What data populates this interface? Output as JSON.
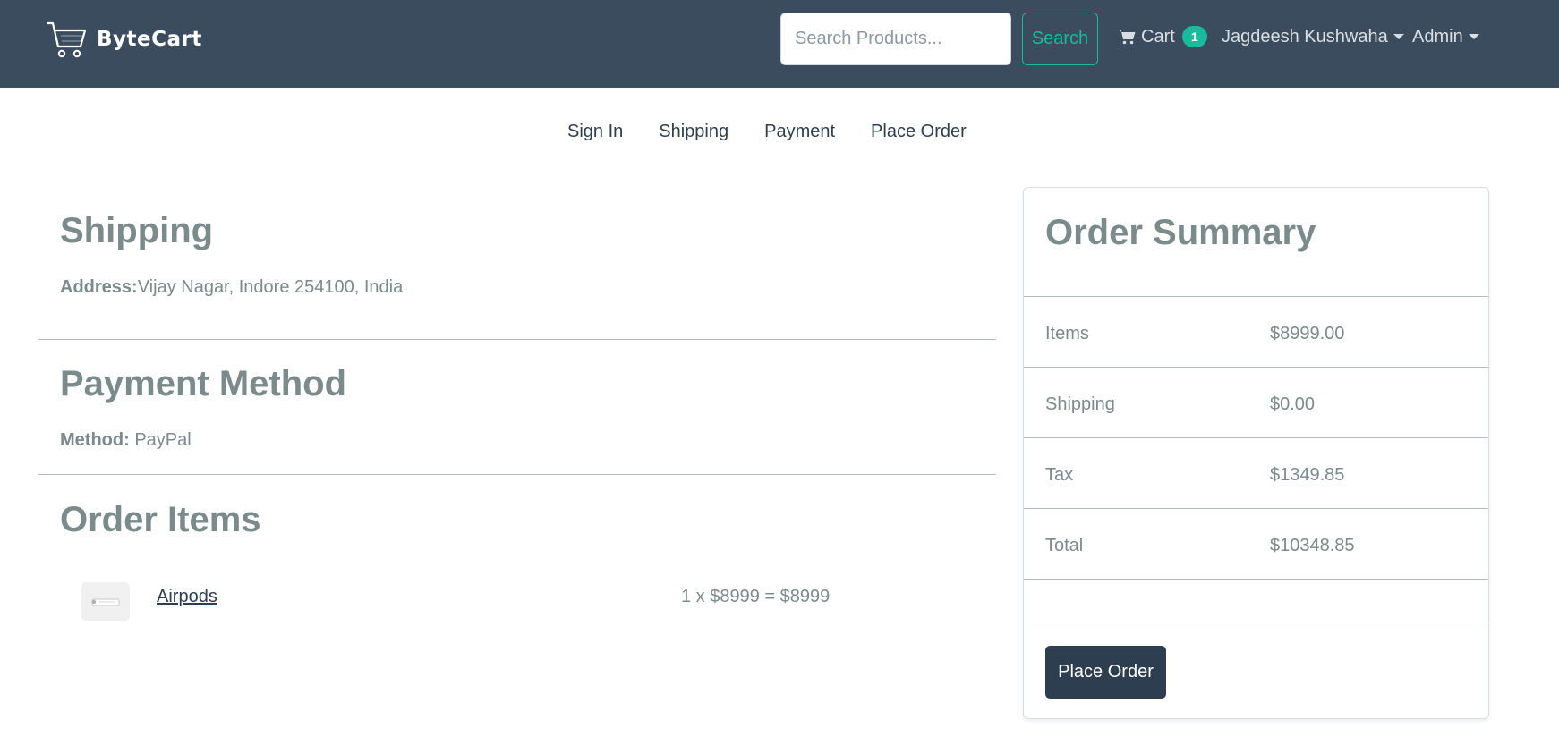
{
  "header": {
    "brand": "ByteCart",
    "search": {
      "placeholder": "Search Products...",
      "button_label": "Search"
    },
    "cart": {
      "label": "Cart",
      "count": "1"
    },
    "user_menu": "Jagdeesh Kushwaha",
    "admin_menu": "Admin"
  },
  "steps": [
    "Sign In",
    "Shipping",
    "Payment",
    "Place Order"
  ],
  "shipping": {
    "title": "Shipping",
    "address_label": "Address:",
    "address_value": "Vijay Nagar, Indore 254100, India"
  },
  "payment": {
    "title": "Payment Method",
    "method_label": "Method:",
    "method_value": "PayPal"
  },
  "order_items": {
    "title": "Order Items",
    "items": [
      {
        "name": "Airpods",
        "calc": "1 x $8999 = $8999"
      }
    ]
  },
  "summary": {
    "title": "Order Summary",
    "rows": [
      {
        "label": "Items",
        "value": "$8999.00"
      },
      {
        "label": "Shipping",
        "value": "$0.00"
      },
      {
        "label": "Tax",
        "value": "$1349.85"
      },
      {
        "label": "Total",
        "value": "$10348.85"
      }
    ],
    "button_label": "Place Order"
  },
  "colors": {
    "navbar": "#3b4c5e",
    "accent": "#18bc9c",
    "primary": "#2c3e50",
    "muted_text": "#7b8a8b"
  }
}
